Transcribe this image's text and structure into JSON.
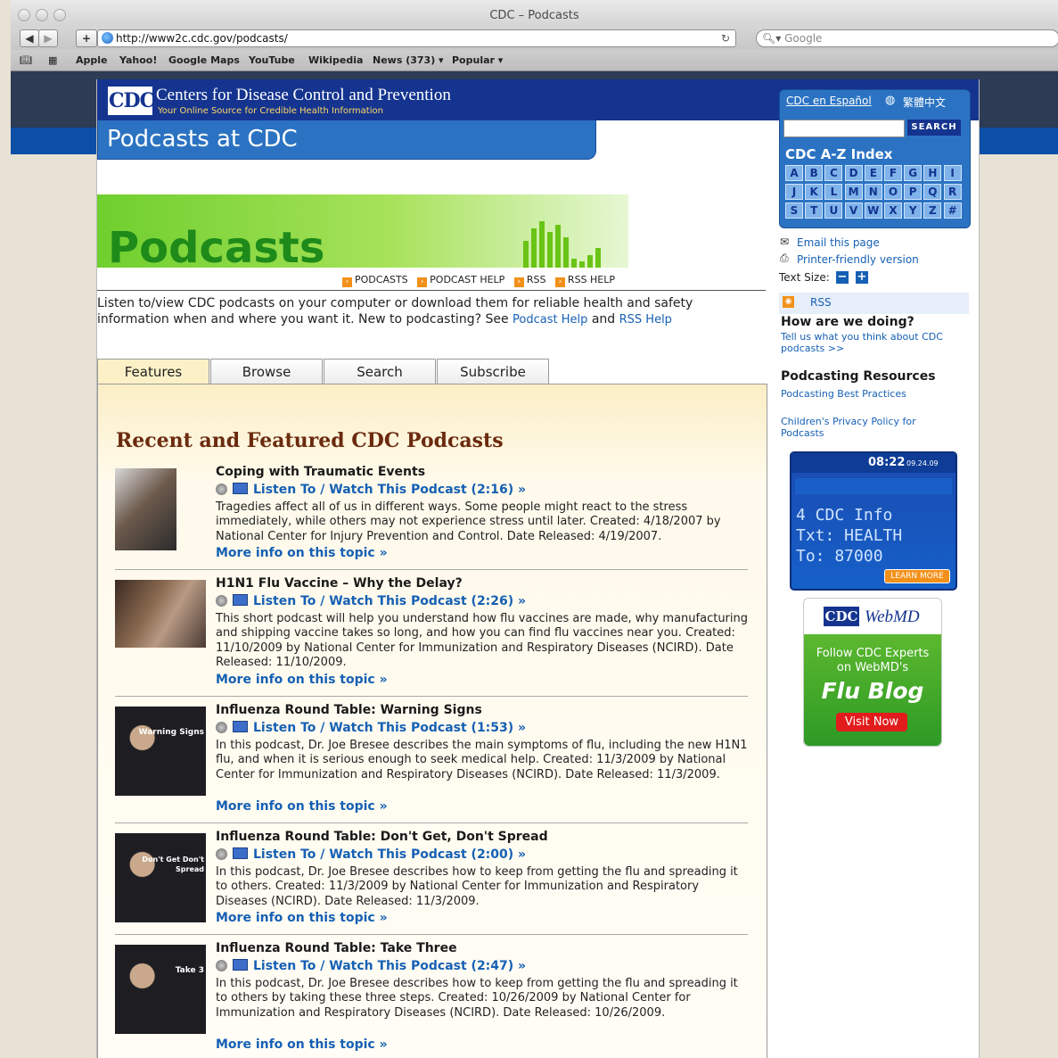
{
  "window": {
    "title": "CDC – Podcasts"
  },
  "toolbar": {
    "url": "http://www2c.cdc.gov/podcasts/",
    "search_placeholder": "Google",
    "add_label": "+"
  },
  "bookmarks": [
    "Apple",
    "Yahoo!",
    "Google Maps",
    "YouTube",
    "Wikipedia",
    "News (373) ▾",
    "Popular ▾"
  ],
  "header": {
    "logo": "CDC",
    "name": "Centers for Disease Control and Prevention",
    "tagline": "Your Online Source for Credible Health Information",
    "banner_title": "Podcasts at CDC"
  },
  "podcasts_banner": {
    "word": "Podcasts"
  },
  "subnav": [
    "PODCASTS",
    "PODCAST HELP",
    "RSS",
    "RSS HELP"
  ],
  "intro": {
    "text": "Listen to/view CDC podcasts on your computer or download them for reliable health and safety information when and where you want it. New to podcasting? See",
    "link1": "Podcast Help",
    "and": "and",
    "link2": "RSS Help"
  },
  "tabs": [
    "Features",
    "Browse",
    "Search",
    "Subscribe"
  ],
  "section_title": "Recent and Featured CDC Podcasts",
  "items": [
    {
      "title": "Coping with Traumatic Events",
      "listen": "Listen To / Watch This Podcast (2:16) »",
      "desc": "Tragedies affect all of us in different ways. Some people might react to the stress immediately, while others may not experience stress until later.  Created: 4/18/2007 by National Center for Injury Prevention and Control.  Date Released: 4/19/2007.",
      "more": "More info on this topic »",
      "thumb_label": ""
    },
    {
      "title": "H1N1 Flu Vaccine – Why the Delay?",
      "listen": "Listen To / Watch This Podcast (2:26) »",
      "desc": "This short podcast will help you understand how flu vaccines are made, why manufacturing and shipping vaccine takes so long, and how you can find flu vaccines near you.  Created: 11/10/2009 by National Center for Immunization and Respiratory Diseases (NCIRD).  Date Released: 11/10/2009.",
      "more": "More info on this topic »",
      "thumb_label": ""
    },
    {
      "title": "Influenza Round Table: Warning Signs",
      "listen": "Listen To / Watch This Podcast (1:53) »",
      "desc": "In this podcast, Dr. Joe Bresee describes the main symptoms of flu, including the new H1N1 flu, and when it is serious enough to seek medical help.  Created: 11/3/2009 by National Center for Immunization and Respiratory Diseases (NCIRD).  Date Released: 11/3/2009.",
      "more": "More info on this topic »",
      "thumb_label": "Warning Signs"
    },
    {
      "title": "Influenza Round Table: Don't Get, Don't Spread",
      "listen": "Listen To / Watch This Podcast (2:00) »",
      "desc": "In this podcast, Dr. Joe Bresee describes how to keep from getting the flu and spreading it to others.  Created: 11/3/2009 by National Center for Immunization and Respiratory Diseases (NCIRD).  Date Released: 11/3/2009.",
      "more": "More info on this topic »",
      "thumb_label": "Don't Get Don't Spread"
    },
    {
      "title": "Influenza Round Table: Take Three",
      "listen": "Listen To / Watch This Podcast (2:47) »",
      "desc": "In this podcast, Dr. Joe Bresee describes how to keep from getting the flu and spreading it to others by taking these three steps.  Created: 10/26/2009 by National Center for Immunization and Respiratory Diseases (NCIRD).  Date Released: 10/26/2009.",
      "more": "More info on this topic »",
      "thumb_label": "Take 3"
    }
  ],
  "sidebar": {
    "espanol": "CDC en Español",
    "chinese": "繁體中文",
    "search_button": "SEARCH",
    "az_title": "CDC A-Z Index",
    "letters": [
      "A",
      "B",
      "C",
      "D",
      "E",
      "F",
      "G",
      "H",
      "I",
      "J",
      "K",
      "L",
      "M",
      "N",
      "O",
      "P",
      "Q",
      "R",
      "S",
      "T",
      "U",
      "V",
      "W",
      "X",
      "Y",
      "Z",
      "#"
    ],
    "email": "Email this page",
    "printer": "Printer-friendly version",
    "text_size": "Text Size:",
    "rss": "RSS",
    "how_title": "How are we doing?",
    "how_link": "Tell us what you think about CDC podcasts >>",
    "resources_title": "Podcasting Resources",
    "resources_link": "Podcasting Best Practices",
    "privacy": "Children's Privacy Policy for Podcasts",
    "phone": {
      "time": "08:22",
      "date": "09.24.09",
      "line1": "4 CDC Info",
      "line2": "Txt: HEALTH",
      "line3": "To: 87000",
      "learn": "LEARN MORE"
    },
    "webmd": {
      "logo_cdc": "CDC",
      "logo_webmd": "WebMD",
      "line1": "Follow CDC Experts",
      "line2": "on WebMD's",
      "blog": "Flu Blog",
      "visit": "Visit Now"
    }
  }
}
